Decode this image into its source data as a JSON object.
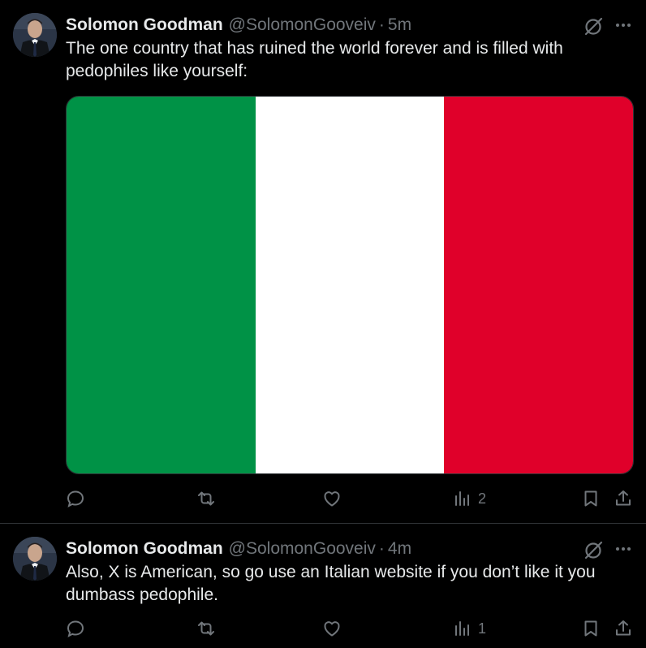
{
  "tweets": [
    {
      "author_name": "Solomon Goodman",
      "handle": "@SolomonGooveiv",
      "separator": "·",
      "time": "5m",
      "text": "The one country that has ruined the world forever and is filled with pedophiles like yourself:",
      "media": {
        "stripes": [
          "#009246",
          "#ffffff",
          "#ce2b37"
        ]
      },
      "views": "2"
    },
    {
      "author_name": "Solomon Goodman",
      "handle": "@SolomonGooveiv",
      "separator": "·",
      "time": "4m",
      "text": "Also, X is American, so go use an Italian website if you don’t like it you dumbass pedophile.",
      "views": "1"
    }
  ],
  "colors": {
    "background": "#000000",
    "text": "#e7e9ea",
    "muted": "#71767b",
    "divider": "#2f3336"
  },
  "icons": [
    "grok-icon",
    "more-icon",
    "reply-icon",
    "retweet-icon",
    "like-icon",
    "views-icon",
    "bookmark-icon",
    "share-icon"
  ]
}
